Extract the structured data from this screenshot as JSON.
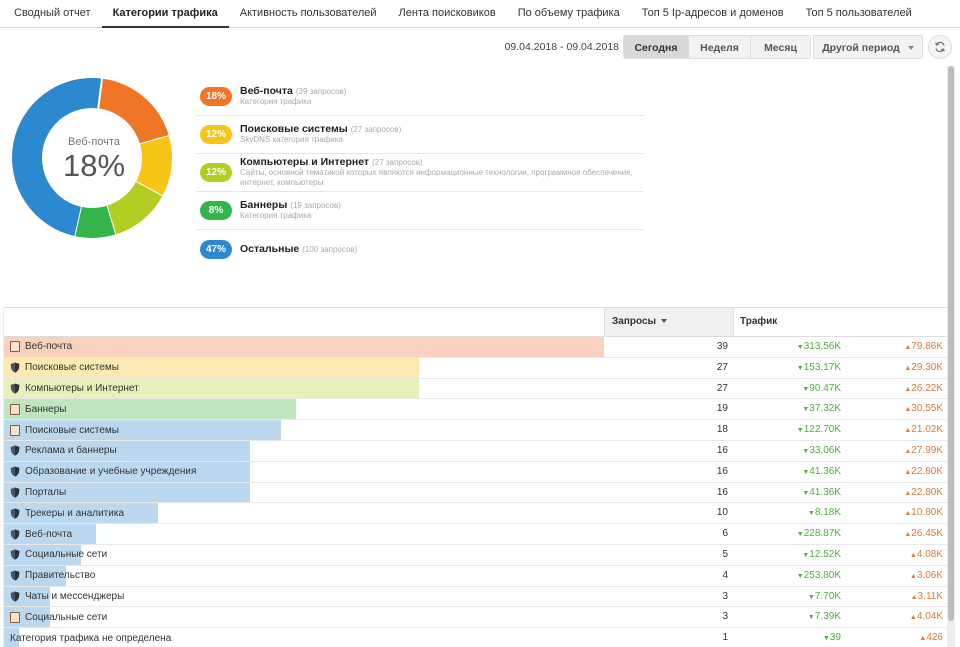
{
  "tabs": [
    {
      "label": "Сводный отчет",
      "active": false
    },
    {
      "label": "Категории трафика",
      "active": true
    },
    {
      "label": "Активность пользователей",
      "active": false
    },
    {
      "label": "Лента поисковиков",
      "active": false
    },
    {
      "label": "По объему трафика",
      "active": false
    },
    {
      "label": "Топ 5 Ip-адресов и доменов",
      "active": false
    },
    {
      "label": "Топ 5 пользователей",
      "active": false
    }
  ],
  "toolbar": {
    "date_range": "09.04.2018 - 09.04.2018",
    "today": "Сегодня",
    "week": "Неделя",
    "month": "Месяц",
    "other": "Другой период"
  },
  "donut": {
    "center_label": "Веб-почта",
    "center_value": "18%",
    "segments": [
      {
        "percent": 18,
        "color": "#ee7626"
      },
      {
        "percent": 12,
        "color": "#f7c517"
      },
      {
        "percent": 12,
        "color": "#b4cd22"
      },
      {
        "percent": 8,
        "color": "#33b54b"
      },
      {
        "percent": 47,
        "color": "#2c88cf"
      }
    ]
  },
  "legend": [
    {
      "badge": "18%",
      "color": "#ee7626",
      "name": "Веб-почта",
      "count": "(39 запросов)",
      "desc": "Категория трафика"
    },
    {
      "badge": "12%",
      "color": "#f7c517",
      "name": "Поисковые системы",
      "count": "(27 запросов)",
      "desc": "SkyDNS категория трафика"
    },
    {
      "badge": "12%",
      "color": "#b4cd22",
      "name": "Компьютеры и Интернет",
      "count": "(27 запросов)",
      "desc": "Сайты, основной тематикой которых являются информационные технологии, программное обеспечение, интернет, компьютеры"
    },
    {
      "badge": "8%",
      "color": "#33b54b",
      "name": "Баннеры",
      "count": "(19 запросов)",
      "desc": "Категория трафика"
    },
    {
      "badge": "47%",
      "color": "#2c88cf",
      "name": "Остальные",
      "count": "(100 запросов)",
      "desc": ""
    }
  ],
  "table": {
    "col_requests": "Запросы",
    "col_traffic": "Трафик",
    "max": 39,
    "rows": [
      {
        "name": "Веб-почта",
        "icon": "book",
        "req": 39,
        "down": "313.56K",
        "up": "79.86K",
        "bar": "#f9d2bd"
      },
      {
        "name": "Поисковые системы",
        "icon": "shield",
        "req": 27,
        "down": "153.17K",
        "up": "29.30K",
        "bar": "#fceab0"
      },
      {
        "name": "Компьютеры и Интернет",
        "icon": "shield",
        "req": 27,
        "down": "90.47K",
        "up": "26.22K",
        "bar": "#e7f0b9"
      },
      {
        "name": "Баннеры",
        "icon": "book",
        "req": 19,
        "down": "37.32K",
        "up": "30.55K",
        "bar": "#bfe6bf"
      },
      {
        "name": "Поисковые системы",
        "icon": "book",
        "req": 18,
        "down": "122.70K",
        "up": "21.02K",
        "bar": "#bcd8ef"
      },
      {
        "name": "Реклама и баннеры",
        "icon": "shield",
        "req": 16,
        "down": "33.06K",
        "up": "27.99K",
        "bar": "#bcd8ef"
      },
      {
        "name": "Образование и учебные учреждения",
        "icon": "shield",
        "req": 16,
        "down": "41.36K",
        "up": "22.80K",
        "bar": "#bcd8ef"
      },
      {
        "name": "Порталы",
        "icon": "shield",
        "req": 16,
        "down": "41.36K",
        "up": "22.80K",
        "bar": "#bcd8ef"
      },
      {
        "name": "Трекеры и аналитика",
        "icon": "shield",
        "req": 10,
        "down": "8.18K",
        "up": "10.80K",
        "bar": "#bcd8ef"
      },
      {
        "name": "Веб-почта",
        "icon": "shield",
        "req": 6,
        "down": "228.87K",
        "up": "26.45K",
        "bar": "#bcd8ef"
      },
      {
        "name": "Социальные сети",
        "icon": "shield",
        "req": 5,
        "down": "12.52K",
        "up": "4.08K",
        "bar": "#bcd8ef"
      },
      {
        "name": "Правительство",
        "icon": "shield",
        "req": 4,
        "down": "253.80K",
        "up": "3.06K",
        "bar": "#bcd8ef"
      },
      {
        "name": "Чаты и мессенджеры",
        "icon": "shield",
        "req": 3,
        "down": "7.70K",
        "up": "3.11K",
        "bar": "#bcd8ef"
      },
      {
        "name": "Социальные сети",
        "icon": "book",
        "req": 3,
        "down": "7.39K",
        "up": "4.04K",
        "bar": "#bcd8ef"
      },
      {
        "name": "Категория трафика не определена",
        "icon": "",
        "req": 1,
        "down": "39",
        "up": "426",
        "bar": "#bcd8ef"
      }
    ]
  }
}
